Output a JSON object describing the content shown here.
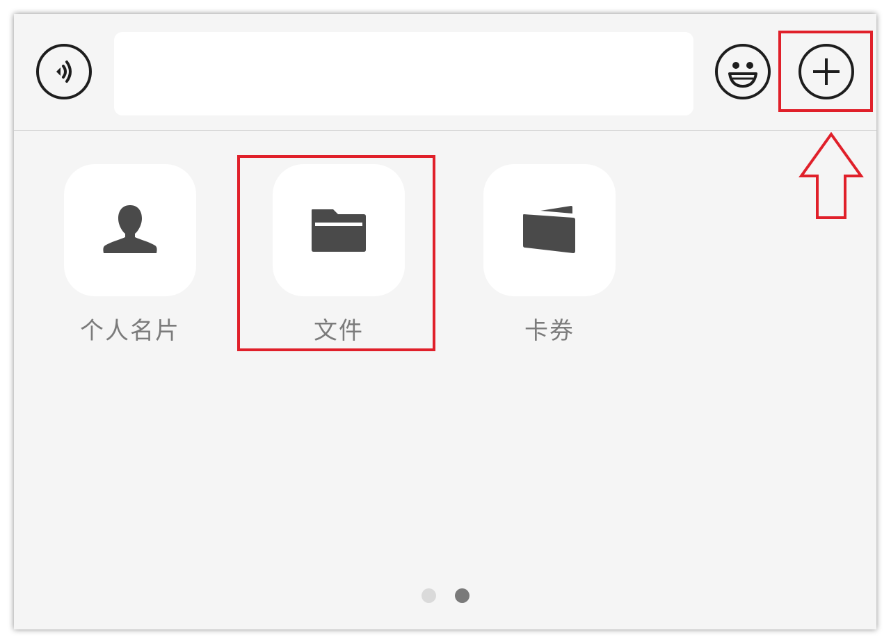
{
  "input_bar": {
    "voice_icon": "voice-icon",
    "text_value": "",
    "emoji_icon": "smiley-icon",
    "more_icon": "plus-icon"
  },
  "panel": {
    "tiles": [
      {
        "label": "个人名片",
        "icon": "person-icon"
      },
      {
        "label": "文件",
        "icon": "folder-icon"
      },
      {
        "label": "卡券",
        "icon": "wallet-icon"
      }
    ],
    "pages": 2,
    "current_page": 2
  },
  "annotations": {
    "color": "#e0202a",
    "highlighted": [
      "plus-button",
      "tile-file"
    ]
  },
  "colors": {
    "background": "#f5f5f5",
    "icon": "#4a4a4a",
    "label": "#7b7b7b"
  }
}
